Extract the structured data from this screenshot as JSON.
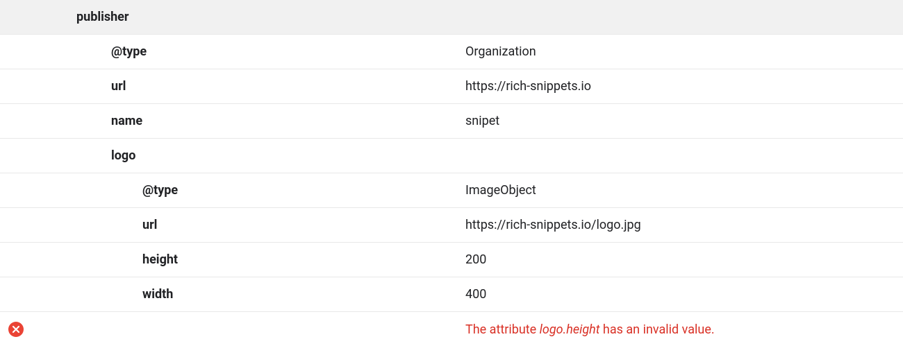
{
  "table": {
    "publisher_label": "publisher",
    "rows": {
      "type": {
        "key": "@type",
        "value": "Organization"
      },
      "url": {
        "key": "url",
        "value": "https://rich-snippets.io"
      },
      "name": {
        "key": "name",
        "value": "snipet"
      },
      "logo_label": "logo",
      "logo": {
        "type": {
          "key": "@type",
          "value": "ImageObject"
        },
        "url": {
          "key": "url",
          "value": "https://rich-snippets.io/logo.jpg"
        },
        "height": {
          "key": "height",
          "value": "200"
        },
        "width": {
          "key": "width",
          "value": "400"
        }
      }
    },
    "error": {
      "prefix": "The attribute ",
      "attribute": "logo.height",
      "suffix": " has an invalid value."
    }
  }
}
